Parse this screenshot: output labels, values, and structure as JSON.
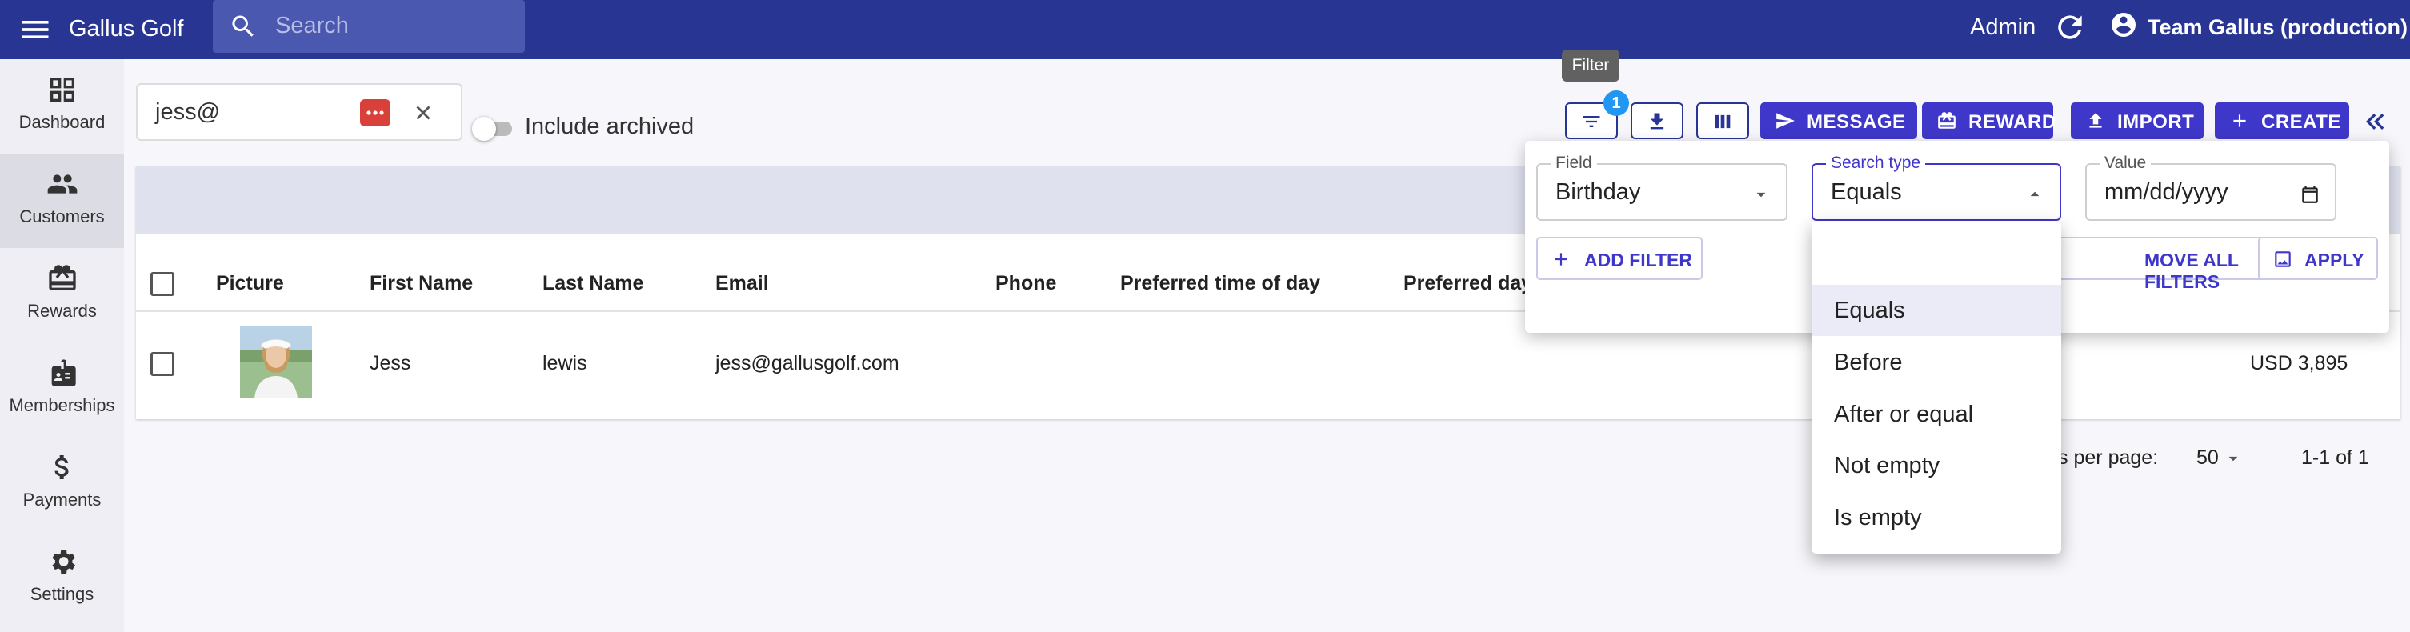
{
  "app": {
    "title": "Gallus Golf"
  },
  "header": {
    "search_placeholder": "Search",
    "admin_label": "Admin",
    "team_label": "Team Gallus (production)"
  },
  "sidebar": {
    "items": [
      {
        "label": "Dashboard",
        "icon": "dashboard-icon"
      },
      {
        "label": "Customers",
        "icon": "people-icon",
        "active": true
      },
      {
        "label": "Rewards",
        "icon": "gift-card-icon"
      },
      {
        "label": "Memberships",
        "icon": "badge-icon"
      },
      {
        "label": "Payments",
        "icon": "dollar-icon"
      },
      {
        "label": "Settings",
        "icon": "gear-icon"
      }
    ]
  },
  "toolbar": {
    "search_value": "jess@",
    "include_archived_label": "Include archived",
    "include_archived": false,
    "tooltip": "Filter",
    "filter_badge": "1",
    "message_label": "MESSAGE",
    "reward_label": "REWARD",
    "import_label": "IMPORT",
    "create_label": "CREATE"
  },
  "table": {
    "columns": [
      "Picture",
      "First Name",
      "Last Name",
      "Email",
      "Phone",
      "Preferred time of day",
      "Preferred day"
    ],
    "rows": [
      {
        "first_name": "Jess",
        "last_name": "lewis",
        "email": "jess@gallusgolf.com",
        "phone": "",
        "amount": "USD 3,895"
      }
    ]
  },
  "pagination": {
    "rows_per_page_label": "ws per page:",
    "rows_per_page": "50",
    "range": "1-1 of 1"
  },
  "filter_panel": {
    "field_label": "Field",
    "field_value": "Birthday",
    "search_type_label": "Search type",
    "search_type_value": "Equals",
    "value_label": "Value",
    "value_placeholder": "mm/dd/yyyy",
    "add_filter_label": "ADD FILTER",
    "remove_all_label": "MOVE ALL FILTERS",
    "apply_label": "APPLY"
  },
  "dropdown": {
    "options": [
      "Equals",
      "Before",
      "After or equal",
      "Not empty",
      "Is empty"
    ],
    "selected": "Equals"
  },
  "colors": {
    "primary": "#283593",
    "accent": "#3f37c9",
    "badge": "#2196f3"
  }
}
